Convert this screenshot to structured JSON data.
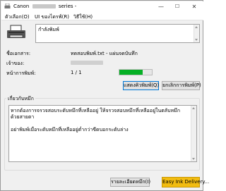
{
  "window": {
    "title_prefix": "Canon",
    "title_suffix": "series -",
    "minimize": "—",
    "maximize": "☐",
    "close": "✕"
  },
  "menu": {
    "items": [
      {
        "label": "ตัวเลือก(O)"
      },
      {
        "label": "UI ของไดรฟ์(R)"
      },
      {
        "label": "วิธีใช้(H)"
      }
    ]
  },
  "status": {
    "message": "กำลังพิมพ์"
  },
  "info": {
    "document_name_label": "ชื่อเอกสาร:",
    "document_name_value": "ทดสอบพิมพ์.txt - แผ่นจดบันทึก",
    "owner_label": "เจ้าของ:",
    "printing_page_label": "หน้าการพิมพ์:",
    "printing_page_value": "1 / 1",
    "progress_fraction": 0.72
  },
  "buttons": {
    "display_print_queue": "แสดงคิวพิมพ์(Q)",
    "cancel_printing": "ยกเลิกการพิมพ์(P)",
    "ink_details": "รายละเอียดหมึก(I)",
    "easy_ink_delivery": "Easy Ink Delivery..."
  },
  "ink": {
    "group_label": "เกี่ยวกับหมึก",
    "message_line1": "หากต้องการจรวจสอบระดับหมึกที่เหลืออยู่ ให้จรวจสอบหมึกที่เหลืออยู่ในตลับหมึกด้วยสายตา",
    "message_line2": "อย่าพิมพ์เมื่อระดับหมึกที่เหลืออยู่ต่ำกว่าขีดบอกระดับล่าง"
  },
  "colors": {
    "progress_green": "#06b025",
    "focus_blue": "#0078d7",
    "accent_button": "#f2bc10"
  }
}
